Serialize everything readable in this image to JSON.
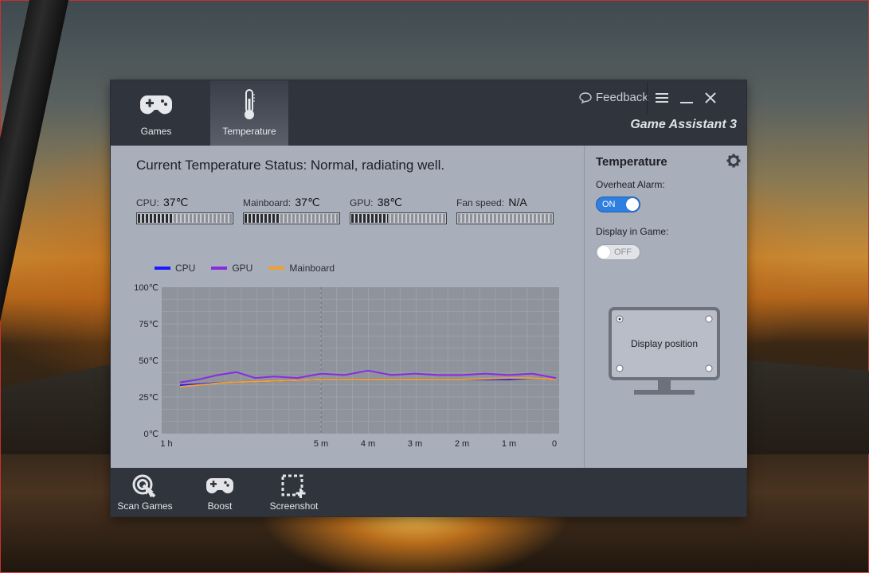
{
  "app": {
    "brand": "Game Assistant 3",
    "feedback_label": "Feedback",
    "tabs": [
      {
        "label": "Games",
        "icon": "gamepad-icon"
      },
      {
        "label": "Temperature",
        "icon": "thermometer-icon"
      }
    ]
  },
  "main": {
    "status": "Current Temperature Status: Normal, radiating well.",
    "gauges": [
      {
        "label": "CPU:",
        "value": "37℃",
        "level": 0.37
      },
      {
        "label": "Mainboard:",
        "value": "37℃",
        "level": 0.37
      },
      {
        "label": "GPU:",
        "value": "38℃",
        "level": 0.38
      },
      {
        "label": "Fan speed:",
        "value": "N/A",
        "level": 0
      }
    ]
  },
  "chart_data": {
    "type": "line",
    "series_colors": {
      "CPU": "#1a1aff",
      "GPU": "#8a2be2",
      "Mainboard": "#f0a030"
    },
    "legend": [
      "CPU",
      "GPU",
      "Mainboard"
    ],
    "x_tick_labels": [
      "1 h",
      "5 m",
      "4 m",
      "3 m",
      "2 m",
      "1 m",
      "0"
    ],
    "y_tick_labels": [
      "100℃",
      "75℃",
      "50℃",
      "25℃",
      "0℃"
    ],
    "ylim": [
      0,
      100
    ],
    "x_unit": "minutes ago",
    "series": [
      {
        "name": "CPU",
        "x": [
          8,
          7,
          6,
          5,
          4,
          3,
          2,
          1,
          0.5,
          0
        ],
        "values": [
          33,
          35,
          36,
          37,
          37,
          37,
          37,
          37,
          38,
          37
        ]
      },
      {
        "name": "GPU",
        "x": [
          8,
          7.6,
          7.2,
          6.8,
          6.4,
          6,
          5.5,
          5,
          4.5,
          4,
          3.5,
          3,
          2.5,
          2,
          1.5,
          1,
          0.5,
          0
        ],
        "values": [
          35,
          37,
          40,
          42,
          38,
          39,
          38,
          41,
          40,
          43,
          40,
          41,
          40,
          40,
          41,
          40,
          41,
          38
        ]
      },
      {
        "name": "Mainboard",
        "x": [
          8,
          7,
          6,
          5,
          4,
          3,
          2,
          1,
          0.5,
          0
        ],
        "values": [
          32,
          35,
          36,
          37,
          37,
          37,
          37,
          38,
          38,
          37
        ]
      }
    ]
  },
  "side": {
    "title": "Temperature",
    "overheat_label": "Overheat Alarm:",
    "overheat_state": "ON",
    "display_label": "Display in Game:",
    "display_state": "OFF",
    "position_label": "Display position"
  },
  "bottom": {
    "buttons": [
      {
        "label": "Scan Games",
        "icon": "scan-icon"
      },
      {
        "label": "Boost",
        "icon": "gamepad-icon"
      },
      {
        "label": "Screenshot",
        "icon": "screenshot-icon"
      }
    ]
  }
}
